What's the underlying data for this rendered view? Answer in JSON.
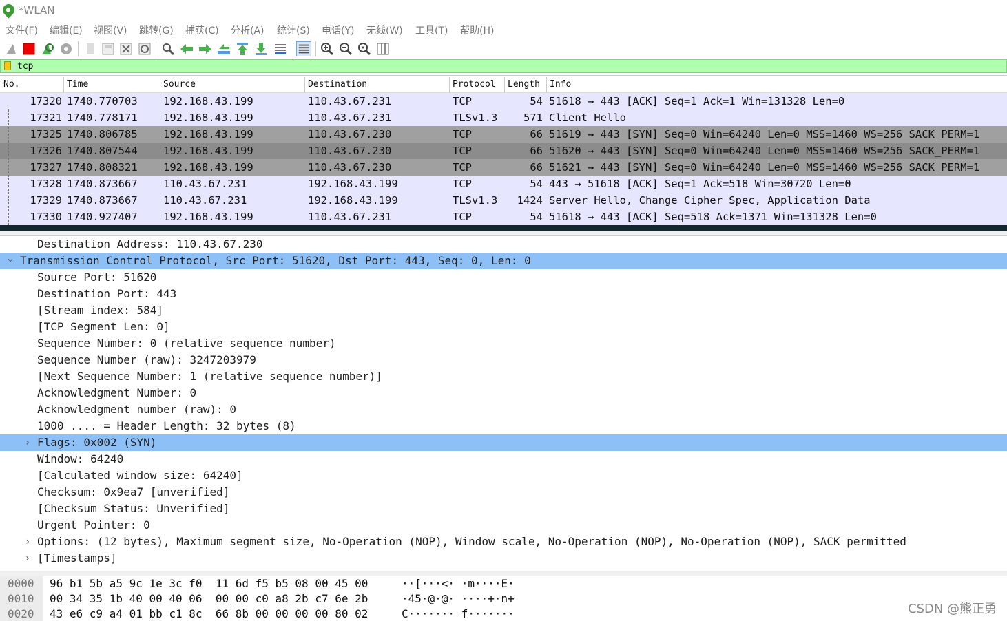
{
  "window": {
    "title": "*WLAN"
  },
  "menu": [
    "文件(F)",
    "编辑(E)",
    "视图(V)",
    "跳转(G)",
    "捕获(C)",
    "分析(A)",
    "统计(S)",
    "电话(Y)",
    "无线(W)",
    "工具(T)",
    "帮助(H)"
  ],
  "toolbar": {
    "icons": [
      "shark-fin-start-icon",
      "stop-capture-icon",
      "restart-capture-icon",
      "capture-options-icon",
      "open-file-icon",
      "save-file-icon",
      "close-file-icon",
      "reload-file-icon",
      "find-packet-icon",
      "go-back-icon",
      "go-forward-icon",
      "go-to-packet-icon",
      "go-first-icon",
      "go-last-icon",
      "autoscroll-icon",
      "colorize-icon",
      "zoom-in-icon",
      "zoom-out-icon",
      "zoom-normal-icon",
      "resize-columns-icon"
    ]
  },
  "filter": {
    "value": "tcp"
  },
  "packet_list": {
    "columns": [
      "No.",
      "Time",
      "Source",
      "Destination",
      "Protocol",
      "Length",
      "Info"
    ],
    "rows": [
      {
        "no": "17320",
        "time": "1740.770703",
        "src": "192.168.43.199",
        "dst": "110.43.67.231",
        "proto": "TCP",
        "len": "54",
        "info": "51618 → 443 [ACK] Seq=1 Ack=1 Win=131328 Len=0",
        "style": "tcp"
      },
      {
        "no": "17321",
        "time": "1740.778171",
        "src": "192.168.43.199",
        "dst": "110.43.67.231",
        "proto": "TLSv1.3",
        "len": "571",
        "info": "Client Hello",
        "style": "tcp"
      },
      {
        "no": "17325",
        "time": "1740.806785",
        "src": "192.168.43.199",
        "dst": "110.43.67.230",
        "proto": "TCP",
        "len": "66",
        "info": "51619 → 443 [SYN] Seq=0 Win=64240 Len=0 MSS=1460 WS=256 SACK_PERM=1",
        "style": "syn"
      },
      {
        "no": "17326",
        "time": "1740.807544",
        "src": "192.168.43.199",
        "dst": "110.43.67.230",
        "proto": "TCP",
        "len": "66",
        "info": "51620 → 443 [SYN] Seq=0 Win=64240 Len=0 MSS=1460 WS=256 SACK_PERM=1",
        "style": "syn sel"
      },
      {
        "no": "17327",
        "time": "1740.808321",
        "src": "192.168.43.199",
        "dst": "110.43.67.230",
        "proto": "TCP",
        "len": "66",
        "info": "51621 → 443 [SYN] Seq=0 Win=64240 Len=0 MSS=1460 WS=256 SACK_PERM=1",
        "style": "syn"
      },
      {
        "no": "17328",
        "time": "1740.873667",
        "src": "110.43.67.231",
        "dst": "192.168.43.199",
        "proto": "TCP",
        "len": "54",
        "info": "443 → 51618 [ACK] Seq=1 Ack=518 Win=30720 Len=0",
        "style": "tcp"
      },
      {
        "no": "17329",
        "time": "1740.873667",
        "src": "110.43.67.231",
        "dst": "192.168.43.199",
        "proto": "TLSv1.3",
        "len": "1424",
        "info": "Server Hello, Change Cipher Spec, Application Data",
        "style": "tcp"
      },
      {
        "no": "17330",
        "time": "1740.927407",
        "src": "192.168.43.199",
        "dst": "110.43.67.231",
        "proto": "TCP",
        "len": "54",
        "info": "51618 → 443 [ACK] Seq=518 Ack=1371 Win=131328 Len=0",
        "style": "tcp"
      }
    ]
  },
  "details": [
    {
      "text": "Destination Address: 110.43.67.230",
      "indent": 1,
      "chevron": "",
      "hl": false
    },
    {
      "text": "Transmission Control Protocol, Src Port: 51620, Dst Port: 443, Seq: 0, Len: 0",
      "indent": 0,
      "chevron": "down",
      "hl": true
    },
    {
      "text": "Source Port: 51620",
      "indent": 1,
      "chevron": "",
      "hl": false
    },
    {
      "text": "Destination Port: 443",
      "indent": 1,
      "chevron": "",
      "hl": false
    },
    {
      "text": "[Stream index: 584]",
      "indent": 1,
      "chevron": "",
      "hl": false
    },
    {
      "text": "[TCP Segment Len: 0]",
      "indent": 1,
      "chevron": "",
      "hl": false
    },
    {
      "text": "Sequence Number: 0    (relative sequence number)",
      "indent": 1,
      "chevron": "",
      "hl": false
    },
    {
      "text": "Sequence Number (raw): 3247203979",
      "indent": 1,
      "chevron": "",
      "hl": false
    },
    {
      "text": "[Next Sequence Number: 1    (relative sequence number)]",
      "indent": 1,
      "chevron": "",
      "hl": false
    },
    {
      "text": "Acknowledgment Number: 0",
      "indent": 1,
      "chevron": "",
      "hl": false
    },
    {
      "text": "Acknowledgment number (raw): 0",
      "indent": 1,
      "chevron": "",
      "hl": false
    },
    {
      "text": "1000 .... = Header Length: 32 bytes (8)",
      "indent": 1,
      "chevron": "",
      "hl": false
    },
    {
      "text": "Flags: 0x002 (SYN)",
      "indent": 1,
      "chevron": "right",
      "hl": true
    },
    {
      "text": "Window: 64240",
      "indent": 1,
      "chevron": "",
      "hl": false
    },
    {
      "text": "[Calculated window size: 64240]",
      "indent": 1,
      "chevron": "",
      "hl": false
    },
    {
      "text": "Checksum: 0x9ea7 [unverified]",
      "indent": 1,
      "chevron": "",
      "hl": false
    },
    {
      "text": "[Checksum Status: Unverified]",
      "indent": 1,
      "chevron": "",
      "hl": false
    },
    {
      "text": "Urgent Pointer: 0",
      "indent": 1,
      "chevron": "",
      "hl": false
    },
    {
      "text": "Options: (12 bytes), Maximum segment size, No-Operation (NOP), Window scale, No-Operation (NOP), No-Operation (NOP), SACK permitted",
      "indent": 1,
      "chevron": "right",
      "hl": false
    },
    {
      "text": "[Timestamps]",
      "indent": 1,
      "chevron": "right",
      "hl": false
    }
  ],
  "bytes": [
    {
      "offset": "0000",
      "hex": "96 b1 5b a5 9c 1e 3c f0  11 6d f5 b5 08 00 45 00",
      "ascii": "··[···<· ·m····E·"
    },
    {
      "offset": "0010",
      "hex": "00 34 35 1b 40 00 40 06  00 00 c0 a8 2b c7 6e 2b",
      "ascii": "·45·@·@· ····+·n+"
    },
    {
      "offset": "0020",
      "hex": "43 e6 c9 a4 01 bb c1 8c  66 8b 00 00 00 00 80 02",
      "ascii": "C······· f·······"
    }
  ],
  "watermark": "CSDN @熊正勇",
  "colors": {
    "filter_ok": "#afffaf",
    "tcp_row": "#e7e6ff",
    "syn_row": "#a0a0a0",
    "selection": "#8ec0f8"
  }
}
